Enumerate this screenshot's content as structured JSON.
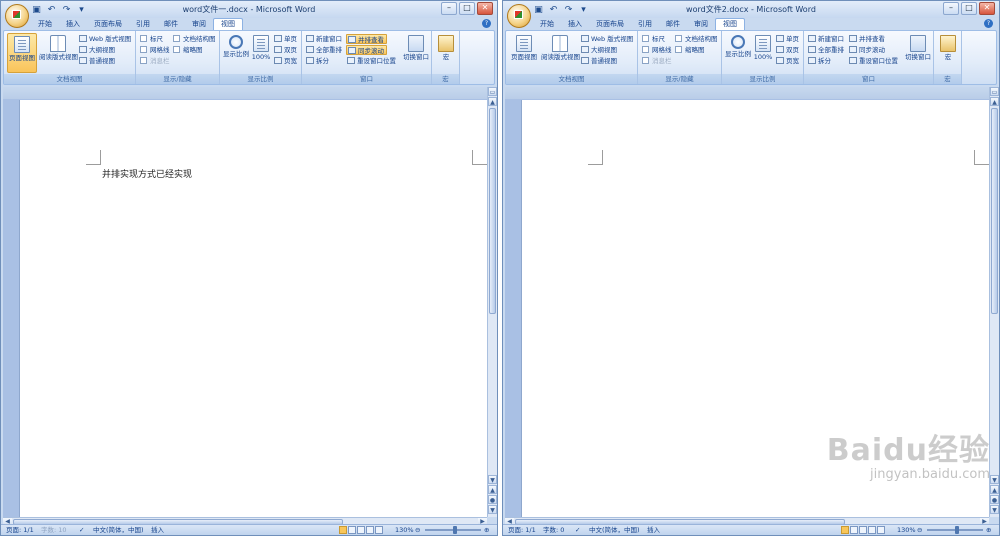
{
  "windows": [
    {
      "title": "word文件一.docx - Microsoft Word",
      "document_text": "并排实现方式已经实现",
      "status": {
        "page": "页面: 1/1",
        "words": "字数: 10",
        "language": "中文(简体，中国)",
        "mode": "插入",
        "zoom": "130%"
      },
      "sync_scroll_active": true
    },
    {
      "title": "word文件2.docx - Microsoft Word",
      "document_text": "",
      "status": {
        "page": "页面: 1/1",
        "words": "字数: 0",
        "language": "中文(简体，中国)",
        "mode": "插入",
        "zoom": "130%"
      },
      "sync_scroll_active": false
    }
  ],
  "tabs": [
    "开始",
    "插入",
    "页面布局",
    "引用",
    "邮件",
    "审阅",
    "视图"
  ],
  "ribbon": {
    "doc_views": {
      "label": "文档视图",
      "page_view": "页面视图",
      "reading_view": "阅读版式视图",
      "web_view": "Web 版式视图",
      "outline_view": "大纲视图",
      "draft_view": "普通视图"
    },
    "show_hide": {
      "label": "显示/隐藏",
      "ruler": "标尺",
      "gridlines": "网格线",
      "message_bar": "消息栏",
      "doc_map": "文档结构图",
      "thumbnails": "缩略图"
    },
    "zoom": {
      "label": "显示比例",
      "zoom": "显示比例",
      "hundred": "100%",
      "one_page": "单页",
      "two_pages": "双页",
      "page_width": "页宽"
    },
    "window": {
      "label": "窗口",
      "new_window": "新建窗口",
      "arrange_all": "全部重排",
      "split": "拆分",
      "side_by_side": "并排查看",
      "sync_scroll": "同步滚动",
      "reset_position": "重设窗口位置",
      "switch_windows": "切换窗口"
    },
    "macros": {
      "label": "宏",
      "macros": "宏"
    }
  },
  "colors": {
    "ribbon_bg": "#dbe7f7",
    "active_button": "#f9c45a",
    "page_bg": "#ffffff",
    "frame": "#c9daf0"
  },
  "watermark": {
    "brand": "Baidu经验",
    "url": "jingyan.baidu.com"
  }
}
